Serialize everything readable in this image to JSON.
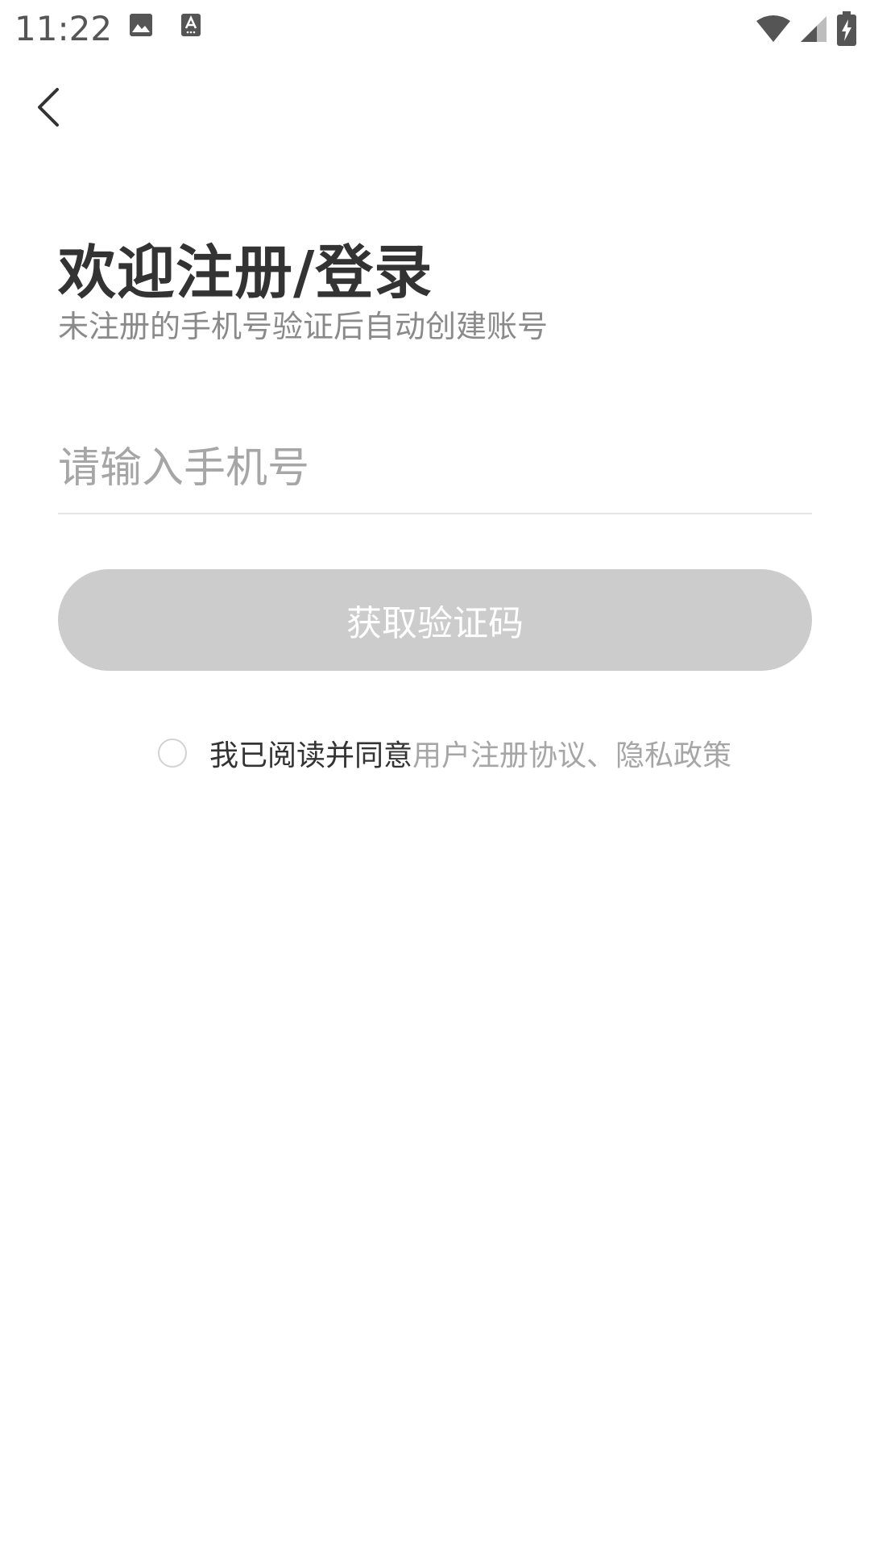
{
  "status_bar": {
    "time": "11:22",
    "icons": [
      "image-icon",
      "text-input-icon",
      "wifi-icon",
      "signal-icon",
      "battery-charging-icon"
    ]
  },
  "nav": {
    "back_icon": "chevron-left-icon"
  },
  "header": {
    "title": "欢迎注册/登录",
    "subtitle": "未注册的手机号验证后自动创建账号"
  },
  "form": {
    "phone_placeholder": "请输入手机号",
    "phone_value": "",
    "submit_label": "获取验证码",
    "submit_color": "#cccccc"
  },
  "agreement": {
    "checked": false,
    "prefix": "我已阅读并同意",
    "user_agreement": "用户注册协议",
    "separator": "、",
    "privacy_policy": "隐私政策"
  }
}
